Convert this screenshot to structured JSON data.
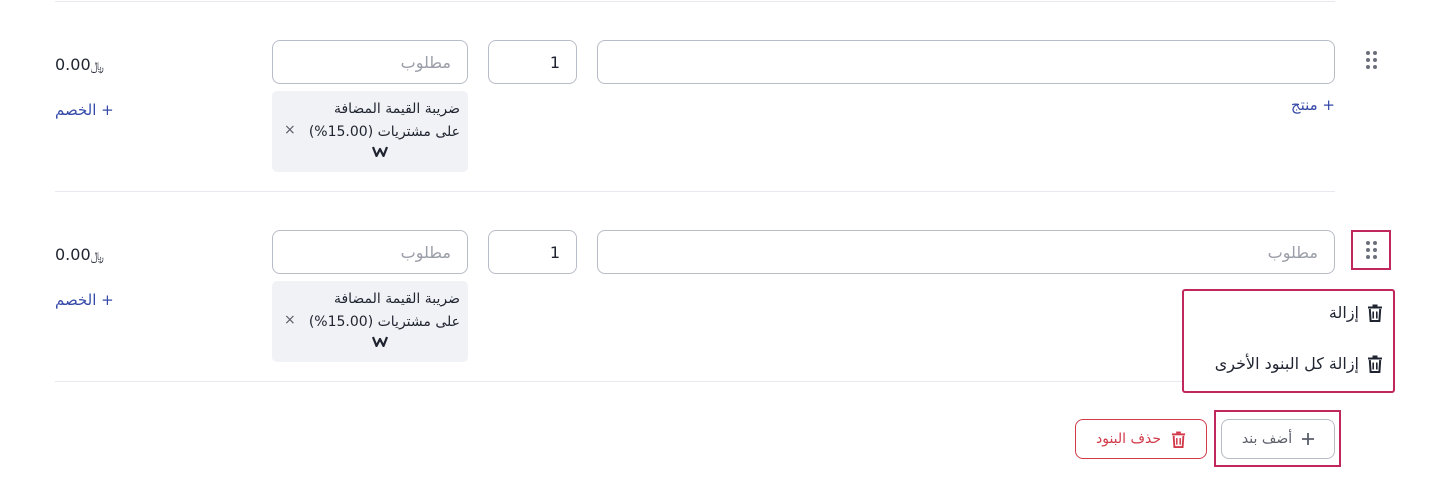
{
  "rows": [
    {
      "product_value": "",
      "product_placeholder": "",
      "quantity": "1",
      "price_placeholder": "مطلوب",
      "product_link": "+ منتج",
      "tax_line1": "ضريبة القيمة المضافة",
      "tax_line2": "على مشتريات (15.00%)",
      "tax_remove": "×",
      "amount": "0.00",
      "currency_symbol": "﷼",
      "discount_link": "+ الخصم"
    },
    {
      "product_value": "",
      "product_placeholder": "مطلوب",
      "quantity": "1",
      "price_placeholder": "مطلوب",
      "tax_line1": "ضريبة القيمة المضافة",
      "tax_line2": "على مشتريات (15.00%)",
      "tax_remove": "×",
      "amount": "0.00",
      "currency_symbol": "﷼",
      "discount_link": "+ الخصم"
    }
  ],
  "context_menu": {
    "remove": "إزالة",
    "remove_all_others": "إزالة كل البنود الأخرى"
  },
  "actions": {
    "add_item": "أضف بند",
    "delete_items": "حذف البنود"
  },
  "colors": {
    "highlight": "#c0275d",
    "link": "#3549a8",
    "danger": "#d23a4a"
  }
}
